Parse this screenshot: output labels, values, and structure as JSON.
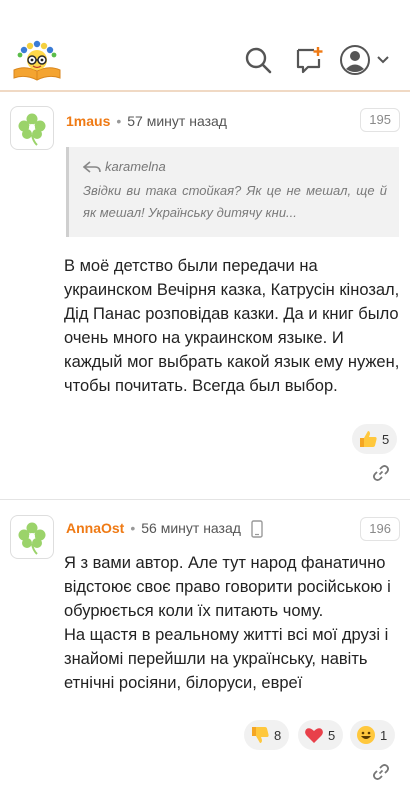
{
  "comments": [
    {
      "username": "1maus",
      "time": "57 минут назад",
      "number": "195",
      "quote": {
        "author": "karamelna",
        "text": "Звідки ви така стойкая? Як це не мешал, ще й як мешал! Українську дитячу кни..."
      },
      "text": "В моё детство были передачи на украинском Вечірня казка, Катрусін кінозал, Дід Панас розповідав казки. Да и книг было очень много на украинском языке. И каждый мог выбрать какой язык ему нужен, чтобы почитать. Всегда был выбор.",
      "reactions": [
        {
          "icon": "thumbs-up-icon",
          "count": "5"
        }
      ]
    },
    {
      "username": "AnnaOst",
      "time": "56 минут назад",
      "number": "196",
      "device": "mobile-device-icon",
      "text": "Я з вами автор. Але тут народ фанатично відстоює своє право говорити російською і обурюється коли їх питають чому.\nНа щастя в реальному житті всі мої друзі і знайомі перейшли на українську, навіть етнічні росіяни, білоруси, евреї",
      "reactions": [
        {
          "icon": "thumbs-down-icon",
          "count": "8"
        },
        {
          "icon": "heart-icon",
          "count": "5"
        },
        {
          "icon": "grin-icon",
          "count": "1"
        }
      ]
    }
  ],
  "colors": {
    "accent": "#ef7a14",
    "avatar_flower": "#9bd36a"
  }
}
